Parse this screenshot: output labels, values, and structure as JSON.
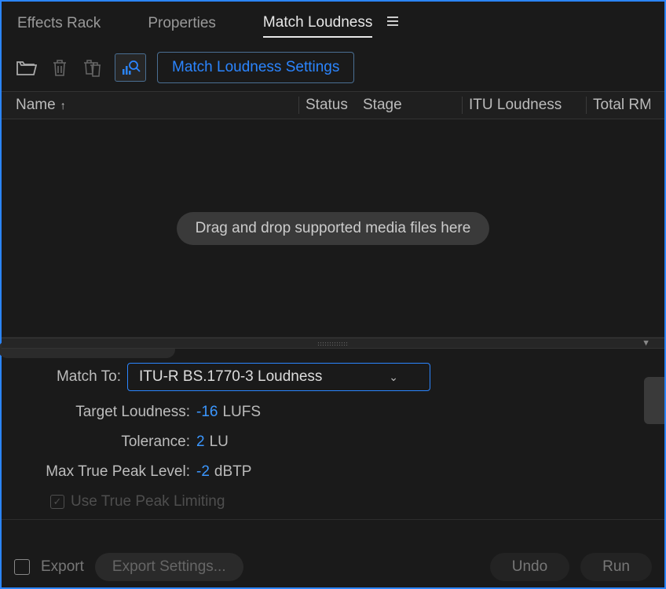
{
  "tabs": {
    "effects_rack": "Effects Rack",
    "properties": "Properties",
    "match_loudness": "Match Loudness"
  },
  "toolbar": {
    "settings_button": "Match Loudness Settings"
  },
  "columns": {
    "name": "Name",
    "status": "Status",
    "stage": "Stage",
    "itu": "ITU Loudness",
    "total_rms": "Total RM"
  },
  "dropzone": {
    "hint": "Drag and drop supported media files here"
  },
  "settings": {
    "match_to_label": "Match To:",
    "match_to_value": "ITU-R BS.1770-3 Loudness",
    "target_loudness_label": "Target Loudness:",
    "target_loudness_value": "-16",
    "target_loudness_unit": "LUFS",
    "tolerance_label": "Tolerance:",
    "tolerance_value": "2",
    "tolerance_unit": "LU",
    "max_true_peak_label": "Max True Peak Level:",
    "max_true_peak_value": "-2",
    "max_true_peak_unit": "dBTP",
    "use_true_peak_limiting": "Use True Peak Limiting"
  },
  "footer": {
    "export": "Export",
    "export_settings": "Export Settings...",
    "undo": "Undo",
    "run": "Run"
  }
}
